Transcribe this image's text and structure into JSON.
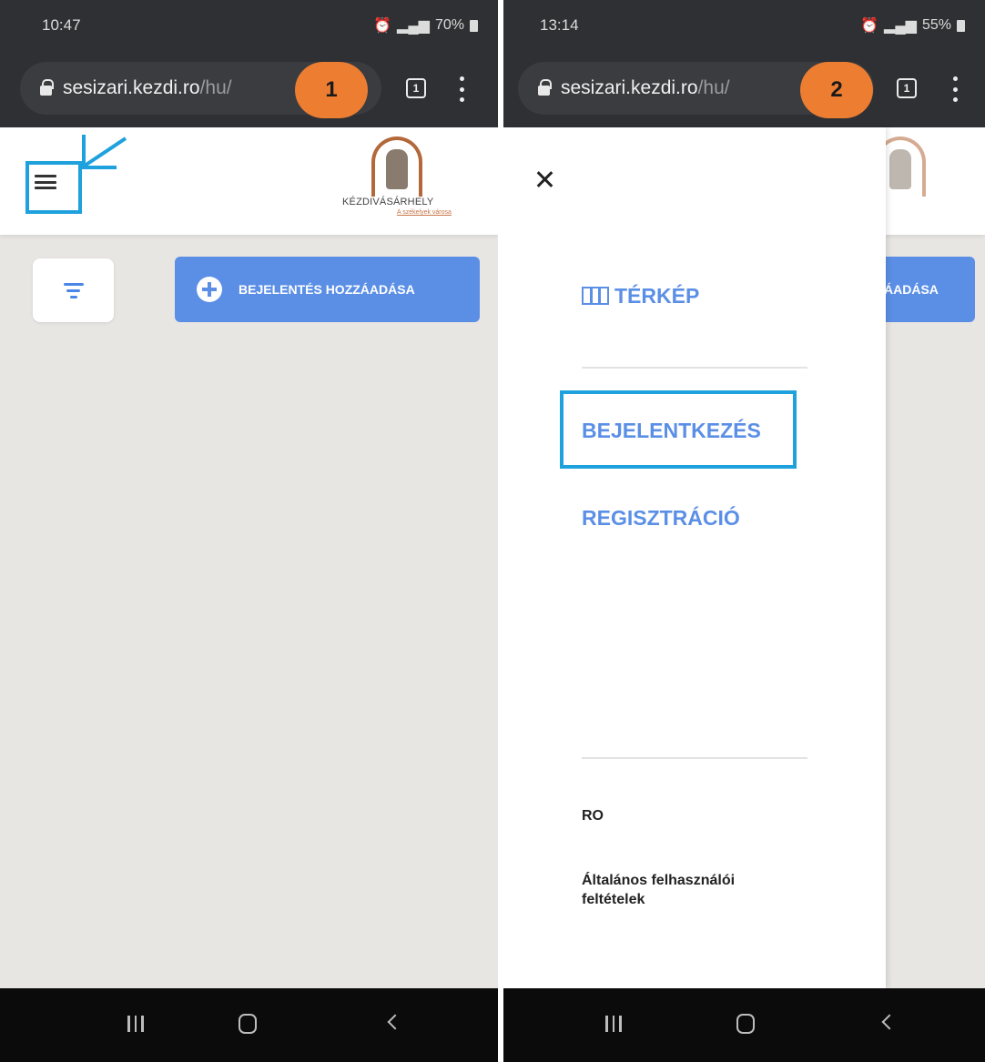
{
  "screen1": {
    "badge": "1",
    "status": {
      "time": "10:47",
      "battery": "70%"
    },
    "url": {
      "host": "sesizari.kezdi.ro",
      "path": "/hu/"
    },
    "tab_count": "1",
    "logo": {
      "name": "KÉZDIVÁSÁRHELY",
      "tagline": "A székelyek városa"
    },
    "add_button_label": "BEJELENTÉS HOZZÁADÁSA"
  },
  "screen2": {
    "badge": "2",
    "status": {
      "time": "13:14",
      "battery": "55%"
    },
    "url": {
      "host": "sesizari.kezdi.ro",
      "path": "/hu/"
    },
    "tab_count": "1",
    "peek_label": "ÁADÁSA",
    "menu": {
      "map_label": "TÉRKÉP",
      "login_label": "BEJELENTKEZÉS",
      "register_label": "REGISZTRÁCIÓ",
      "language_label": "RO",
      "terms_label": "Általános felhasználói feltételek"
    }
  },
  "colors": {
    "accent": "#5b8fe6",
    "highlight": "#1ea1dc",
    "badge": "#ed7d31"
  }
}
